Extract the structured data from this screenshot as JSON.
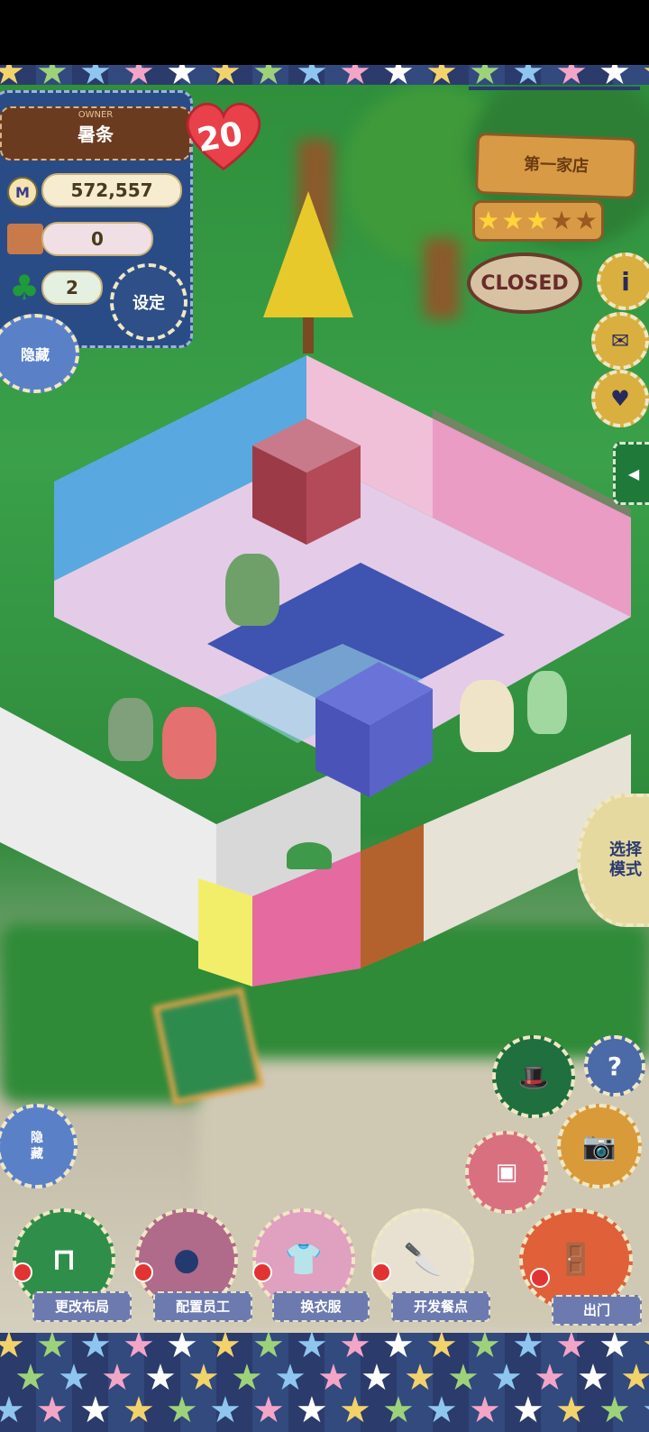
{
  "hud": {
    "owner_caption": "OWNER",
    "owner_name": "暑条",
    "level": "20",
    "money": "572,557",
    "food_count": "0",
    "clover_count": "2",
    "settings_label": "设定",
    "hide_top_label": "隐藏",
    "hide_bottom_label": "隐\n藏"
  },
  "shop_sign": {
    "name": "第一家店",
    "stars_filled": 3,
    "stars_total": 5,
    "status": "CLOSED"
  },
  "side_buttons": {
    "select_mode": "选择\n模式"
  },
  "bottom_menu": [
    {
      "label": "更改布局",
      "icon": "table-icon"
    },
    {
      "label": "配置员工",
      "icon": "bear-head-icon"
    },
    {
      "label": "换衣服",
      "icon": "shirt-icon"
    },
    {
      "label": "开发餐点",
      "icon": "knife-icon"
    },
    {
      "label": "出门",
      "icon": "door-icon"
    }
  ],
  "colors": {
    "denim": "#2a4c86",
    "grass": "#3aa049",
    "heart": "#e8414a",
    "wood": "#d99a45"
  }
}
